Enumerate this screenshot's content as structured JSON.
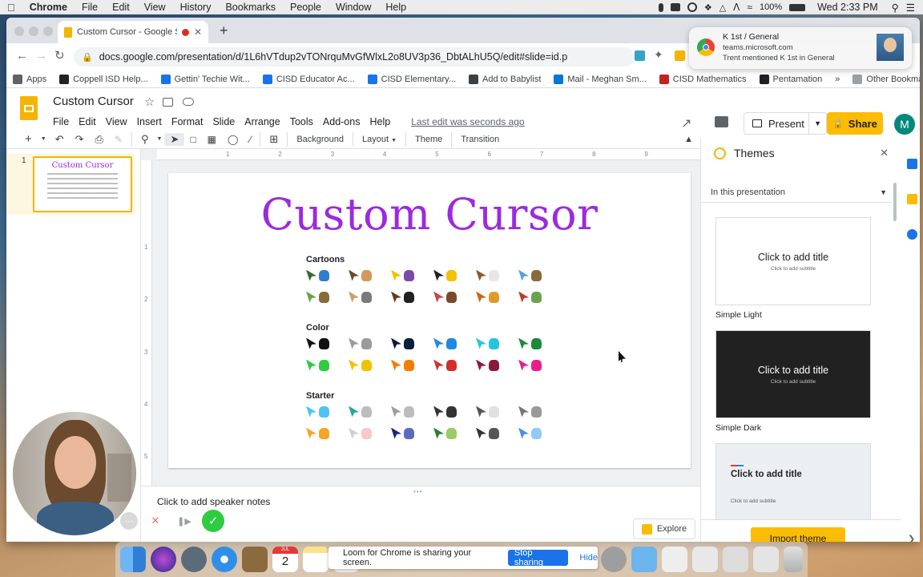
{
  "mac_menu": {
    "app": "Chrome",
    "items": [
      "File",
      "Edit",
      "View",
      "History",
      "Bookmarks",
      "People",
      "Window",
      "Help"
    ],
    "battery": "100%",
    "clock": "Wed 2:33 PM"
  },
  "browser": {
    "tab_title": "Custom Cursor - Google Sl",
    "url": "docs.google.com/presentation/d/1L6hVTdup2vTONrquMvGfWlxL2o8UV3p36_DbtALhU5Q/edit#slide=id.p",
    "bookmarks": [
      {
        "label": "Apps",
        "color": "#5f6368"
      },
      {
        "label": "Coppell ISD Help...",
        "color": "#202124"
      },
      {
        "label": "Gettin' Techie Wit...",
        "color": "#1a73e8"
      },
      {
        "label": "CISD Educator Ac...",
        "color": "#1a73e8"
      },
      {
        "label": "CISD Elementary...",
        "color": "#1a73e8"
      },
      {
        "label": "Add to Babylist",
        "color": "#3c4043"
      },
      {
        "label": "Mail - Meghan Sm...",
        "color": "#0078d4"
      },
      {
        "label": "CISD Mathematics",
        "color": "#c5221f"
      },
      {
        "label": "Pentamation",
        "color": "#202124"
      }
    ],
    "more_bookmarks": "»",
    "other_bookmarks": "Other Bookmarks"
  },
  "notification": {
    "title": "K 1st / General",
    "source": "teams.microsoft.com",
    "message": "Trent mentioned K 1st in General"
  },
  "doc": {
    "title": "Custom Cursor",
    "menu": [
      "File",
      "Edit",
      "View",
      "Insert",
      "Format",
      "Slide",
      "Arrange",
      "Tools",
      "Add-ons",
      "Help"
    ],
    "last_edit": "Last edit was seconds ago",
    "present_label": "Present",
    "share_label": "Share",
    "avatar_letter": "M"
  },
  "toolbar": {
    "background": "Background",
    "layout": "Layout",
    "theme": "Theme",
    "transition": "Transition"
  },
  "filmstrip": {
    "slide_number": "1"
  },
  "ruler": {
    "h_ticks": [
      "1",
      "2",
      "3",
      "4",
      "5",
      "6",
      "7",
      "8",
      "9"
    ],
    "v_ticks": [
      "1",
      "2",
      "3",
      "4",
      "5"
    ]
  },
  "slide": {
    "title": "Custom Cursor",
    "sections": [
      {
        "label": "Cartoons",
        "rows": [
          [
            [
              "#3a6b2e",
              "#2e7dd1"
            ],
            [
              "#6b4b2a",
              "#d19a5a"
            ],
            [
              "#f2c200",
              "#7b4aa8"
            ],
            [
              "#202124",
              "#f2c200"
            ],
            [
              "#8a5a2b",
              "#e6e6e6"
            ],
            [
              "#5aa0d8",
              "#8a6a3a"
            ]
          ],
          [
            [
              "#6aa34b",
              "#8a6a3a"
            ],
            [
              "#c8a06a",
              "#7a7a7a"
            ],
            [
              "#6b3b1b",
              "#202124"
            ],
            [
              "#c44",
              "#7a4a2a"
            ],
            [
              "#c8661a",
              "#e09a2a"
            ],
            [
              "#c0392b",
              "#6aa34b"
            ]
          ]
        ]
      },
      {
        "label": "Color",
        "rows": [
          [
            [
              "#111111",
              "#111111"
            ],
            [
              "#9a9a9a",
              "#9a9a9a"
            ],
            [
              "#0b1f3a",
              "#0b1f3a"
            ],
            [
              "#1e88e5",
              "#1e88e5"
            ],
            [
              "#26c6da",
              "#26c6da"
            ],
            [
              "#1b8a3a",
              "#1b8a3a"
            ]
          ],
          [
            [
              "#2ecc40",
              "#2ecc40"
            ],
            [
              "#f2c200",
              "#f2c200"
            ],
            [
              "#f57c00",
              "#f57c00"
            ],
            [
              "#d32f2f",
              "#d32f2f"
            ],
            [
              "#8b1a3a",
              "#8b1a3a"
            ],
            [
              "#e91e8c",
              "#e91e8c"
            ]
          ]
        ]
      },
      {
        "label": "Starter",
        "rows": [
          [
            [
              "#4fc3f7",
              "#4fc3f7"
            ],
            [
              "#26a69a",
              "#bdbdbd"
            ],
            [
              "#9e9e9e",
              "#bdbdbd"
            ],
            [
              "#333333",
              "#333333"
            ],
            [
              "#555555",
              "#e0e0e0"
            ],
            [
              "#777777",
              "#999999"
            ]
          ],
          [
            [
              "#f5a623",
              "#f5a623"
            ],
            [
              "#d0d0d0",
              "#f8c8c8"
            ],
            [
              "#1a237e",
              "#5c6bc0"
            ],
            [
              "#2e7d32",
              "#9ccc65"
            ],
            [
              "#333333",
              "#555555"
            ],
            [
              "#4a90e2",
              "#90caf9"
            ]
          ]
        ]
      }
    ],
    "speaker_notes": "Click to add speaker notes",
    "explore_label": "Explore"
  },
  "themes_panel": {
    "title": "Themes",
    "filter": "In this presentation",
    "cards": [
      {
        "title": "Click to add title",
        "subtitle": "Click to add subtitle",
        "name": "Simple Light",
        "bg": "#ffffff",
        "fg": "#202124"
      },
      {
        "title": "Click to add title",
        "subtitle": "Click to add subtitle",
        "name": "Simple Dark",
        "bg": "#212121",
        "fg": "#ffffff"
      },
      {
        "title": "Click to add title",
        "subtitle": "Click to add subtitle",
        "name": "",
        "bg": "#eceff1",
        "fg": "#202124"
      }
    ],
    "import_label": "Import theme"
  },
  "screen_share": {
    "message": "Loom for Chrome is sharing your screen.",
    "stop_label": "Stop sharing",
    "hide_label": "Hide"
  },
  "dock": {
    "calendar_month": "JUL",
    "calendar_day": "2"
  },
  "colors": {
    "accent_yellow": "#fbbc04",
    "title_purple": "#9b2ae0",
    "link_blue": "#1a73e8"
  }
}
